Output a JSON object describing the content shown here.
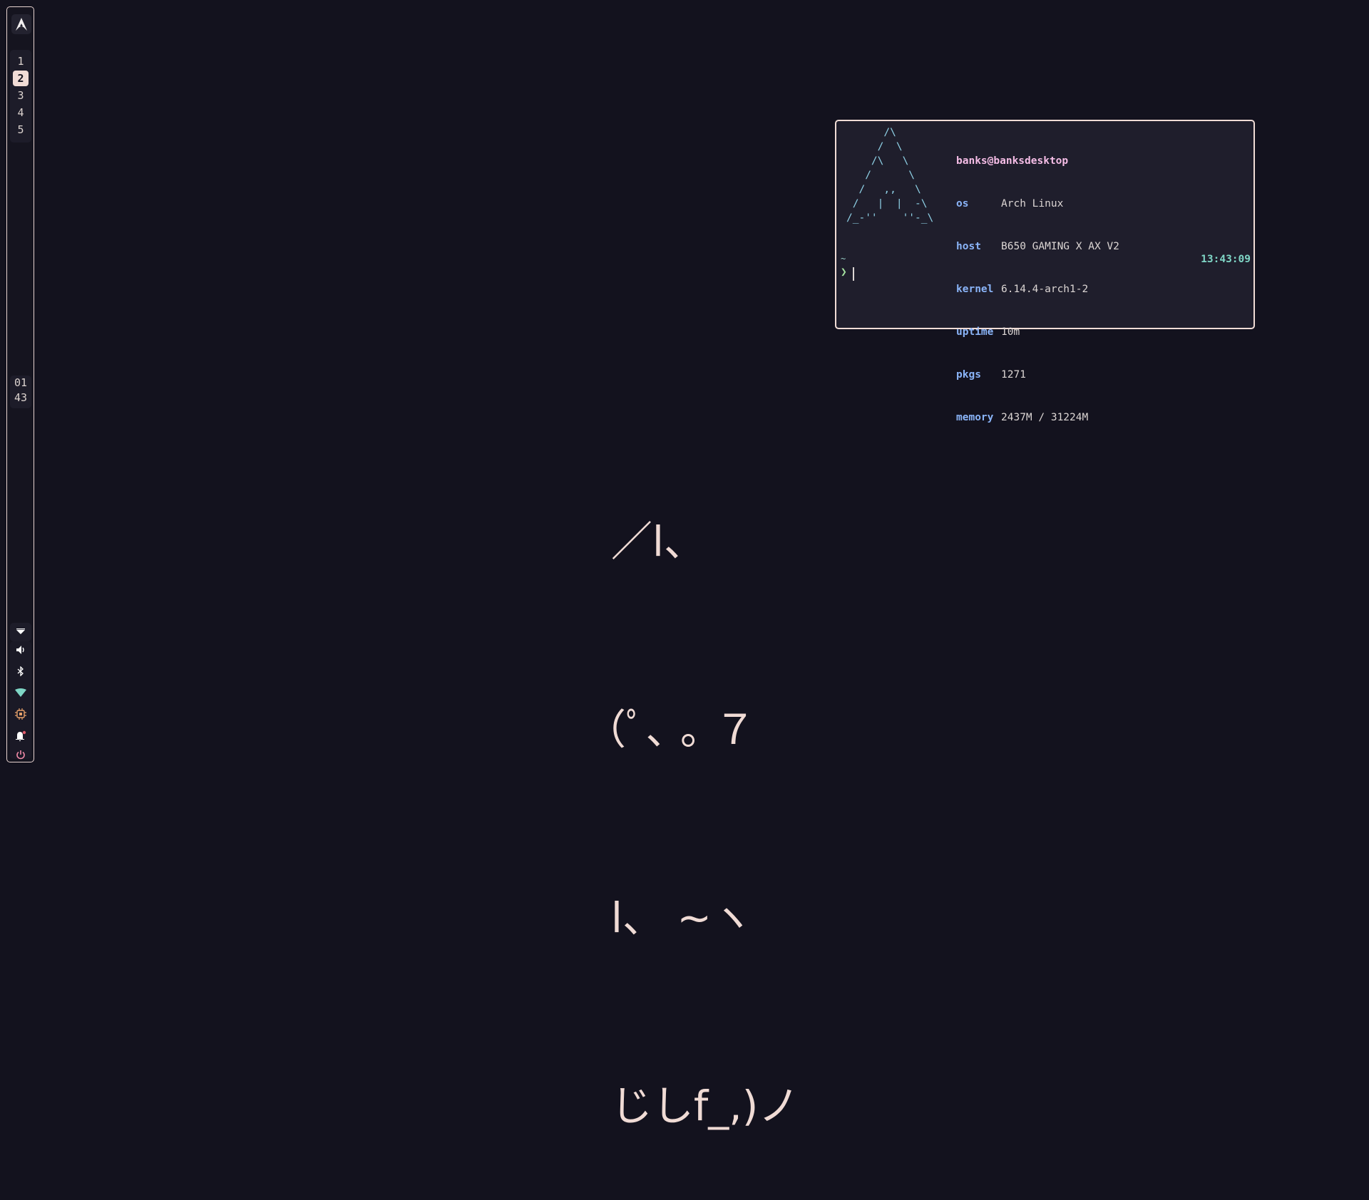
{
  "sidebar": {
    "logo_icon": "arch-logo-icon",
    "workspaces": [
      {
        "label": "1",
        "active": false
      },
      {
        "label": "2",
        "active": true
      },
      {
        "label": "3",
        "active": false
      },
      {
        "label": "4",
        "active": false
      },
      {
        "label": "5",
        "active": false
      }
    ],
    "clock": {
      "hour": "01",
      "minute": "43"
    },
    "tray": [
      {
        "name": "tray-expand-icon",
        "color": "#ffffff"
      },
      {
        "name": "volume-icon",
        "color": "#ffffff"
      },
      {
        "name": "bluetooth-icon",
        "color": "#ffffff"
      },
      {
        "name": "wifi-icon",
        "color": "#7fd6c6"
      },
      {
        "name": "cpu-icon",
        "color": "#e6a06a"
      },
      {
        "name": "notification-bell-icon",
        "color": "#ffffff"
      },
      {
        "name": "power-icon",
        "color": "#f38ba8"
      }
    ],
    "accent": "#f1dcd6"
  },
  "terminal": {
    "ascii_logo": "      /\\\n     /  \\\n    /\\   \\\n   /      \\\n  /   ,,   \\\n /   |  |  -\\\n/_-''    ''-_\\",
    "user_host": "banks@banksdesktop",
    "info": [
      {
        "key": "os",
        "value": "Arch Linux"
      },
      {
        "key": "host",
        "value": "B650 GAMING X AX V2"
      },
      {
        "key": "kernel",
        "value": "6.14.4-arch1-2"
      },
      {
        "key": "uptime",
        "value": "10m"
      },
      {
        "key": "pkgs",
        "value": "1271"
      },
      {
        "key": "memory",
        "value": "2437M / 31224M"
      }
    ],
    "cwd": "~",
    "time": "13:43:09",
    "prompt_symbol": "❯"
  },
  "wallpaper_art": {
    "lines": [
      "  ／l、",
      "（ﾟ､ ｡ ７",
      "  l、 ~ヽ",
      "  じしf_,)ノ"
    ],
    "color": "#f0dbd5"
  }
}
